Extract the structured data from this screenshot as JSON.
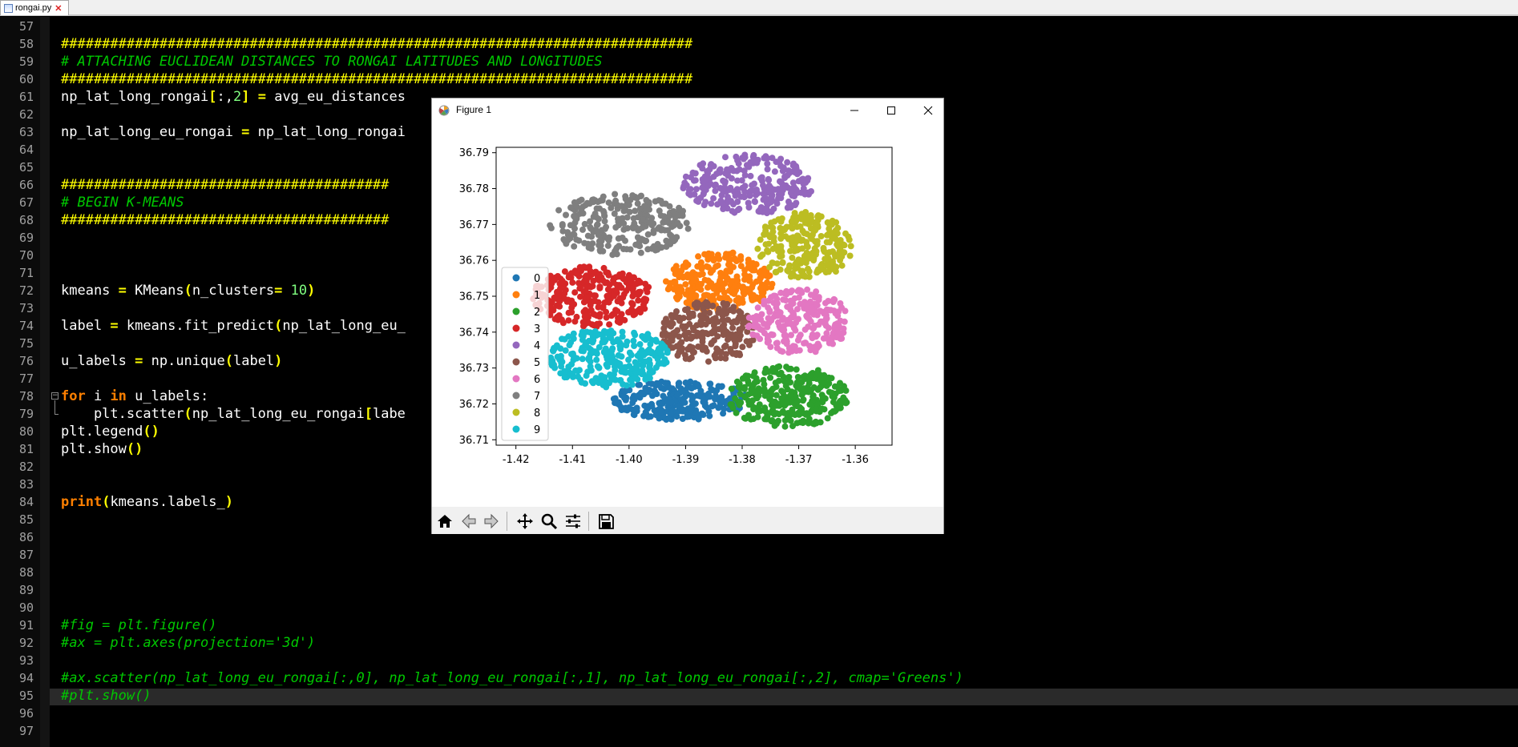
{
  "tab": {
    "filename": "rongai.py"
  },
  "editor": {
    "lines": [
      {
        "n": "57",
        "html": ""
      },
      {
        "n": "58",
        "html": "<span class='hash'>#############################################################################</span>"
      },
      {
        "n": "59",
        "html": "<span class='cmt'># ATTACHING EUCLIDEAN DISTANCES TO RONGAI LATITUDES AND LONGITUDES</span>"
      },
      {
        "n": "60",
        "html": "<span class='hash'>#############################################################################</span>"
      },
      {
        "n": "61",
        "html": "np_lat_long_rongai<span class='op'>[</span>:,<span class='num'>2</span><span class='op'>]</span> <span class='op'>=</span> avg_eu_distances"
      },
      {
        "n": "62",
        "html": ""
      },
      {
        "n": "63",
        "html": "np_lat_long_eu_rongai <span class='op'>=</span> np_lat_long_rongai"
      },
      {
        "n": "64",
        "html": ""
      },
      {
        "n": "65",
        "html": ""
      },
      {
        "n": "66",
        "html": "<span class='hash'>########################################</span>"
      },
      {
        "n": "67",
        "html": "<span class='cmt'># BEGIN K-MEANS</span>"
      },
      {
        "n": "68",
        "html": "<span class='hash'>########################################</span>"
      },
      {
        "n": "69",
        "html": ""
      },
      {
        "n": "70",
        "html": ""
      },
      {
        "n": "71",
        "html": ""
      },
      {
        "n": "72",
        "html": "kmeans <span class='op'>=</span> KMeans<span class='op'>(</span>n_clusters<span class='op'>=</span> <span class='num'>10</span><span class='op'>)</span>"
      },
      {
        "n": "73",
        "html": ""
      },
      {
        "n": "74",
        "html": "label <span class='op'>=</span> kmeans.fit_predict<span class='op'>(</span>np_lat_long_eu_"
      },
      {
        "n": "75",
        "html": ""
      },
      {
        "n": "76",
        "html": "u_labels <span class='op'>=</span> np.unique<span class='op'>(</span>label<span class='op'>)</span>"
      },
      {
        "n": "77",
        "html": ""
      },
      {
        "n": "78",
        "html": "<span class='kw'>for</span> i <span class='kw'>in</span> u_labels:"
      },
      {
        "n": "79",
        "html": "    plt.scatter<span class='op'>(</span>np_lat_long_eu_rongai<span class='op'>[</span>labe                                                      l <span class='op'>=</span> i<span class='op'>)</span>"
      },
      {
        "n": "80",
        "html": "plt.legend<span class='op'>()</span>"
      },
      {
        "n": "81",
        "html": "plt.show<span class='op'>()</span>"
      },
      {
        "n": "82",
        "html": ""
      },
      {
        "n": "83",
        "html": ""
      },
      {
        "n": "84",
        "html": "<span class='kw'>print</span><span class='op'>(</span>kmeans.labels_<span class='op'>)</span>"
      },
      {
        "n": "85",
        "html": ""
      },
      {
        "n": "86",
        "html": ""
      },
      {
        "n": "87",
        "html": ""
      },
      {
        "n": "88",
        "html": ""
      },
      {
        "n": "89",
        "html": ""
      },
      {
        "n": "90",
        "html": ""
      },
      {
        "n": "91",
        "html": "<span class='cmt'>#fig = plt.figure()</span>"
      },
      {
        "n": "92",
        "html": "<span class='cmt'>#ax = plt.axes(projection='3d')</span>"
      },
      {
        "n": "93",
        "html": ""
      },
      {
        "n": "94",
        "html": "<span class='cmt'>#ax.scatter(np_lat_long_eu_rongai[:,0], np_lat_long_eu_rongai[:,1], np_lat_long_eu_rongai[:,2], cmap='Greens')</span>"
      },
      {
        "n": "95",
        "html": "<span class='cmt'>#plt.show()</span>"
      },
      {
        "n": "96",
        "html": ""
      },
      {
        "n": "97",
        "html": ""
      }
    ]
  },
  "figure": {
    "title": "Figure 1",
    "minimize": "🗕",
    "maximize": "☐",
    "close": "✕"
  },
  "chart_data": {
    "type": "scatter",
    "xlim": [
      -1.4235,
      -1.3535
    ],
    "ylim": [
      36.7085,
      36.7915
    ],
    "xticks": [
      "-1.42",
      "-1.41",
      "-1.40",
      "-1.39",
      "-1.38",
      "-1.37",
      "-1.36"
    ],
    "xtick_values": [
      -1.42,
      -1.41,
      -1.4,
      -1.39,
      -1.38,
      -1.37,
      -1.36
    ],
    "yticks": [
      "36.71",
      "36.72",
      "36.73",
      "36.74",
      "36.75",
      "36.76",
      "36.77",
      "36.78",
      "36.79"
    ],
    "ytick_values": [
      36.71,
      36.72,
      36.73,
      36.74,
      36.75,
      36.76,
      36.77,
      36.78,
      36.79
    ],
    "legend_position": "left",
    "series": [
      {
        "name": "0",
        "color": "#1f77b4",
        "cx": -1.391,
        "cy": 36.721,
        "rx": 0.012,
        "ry": 0.0055,
        "n": 260
      },
      {
        "name": "1",
        "color": "#ff7f0e",
        "cx": -1.384,
        "cy": 36.754,
        "rx": 0.0095,
        "ry": 0.0085,
        "n": 260
      },
      {
        "name": "2",
        "color": "#2ca02c",
        "cx": -1.372,
        "cy": 36.722,
        "rx": 0.011,
        "ry": 0.0085,
        "n": 300
      },
      {
        "name": "3",
        "color": "#d62728",
        "cx": -1.4065,
        "cy": 36.75,
        "rx": 0.0105,
        "ry": 0.0085,
        "n": 280
      },
      {
        "name": "4",
        "color": "#9467bd",
        "cx": -1.379,
        "cy": 36.781,
        "rx": 0.0115,
        "ry": 0.0085,
        "n": 260
      },
      {
        "name": "5",
        "color": "#8c564b",
        "cx": -1.386,
        "cy": 36.74,
        "rx": 0.0085,
        "ry": 0.0085,
        "n": 220
      },
      {
        "name": "6",
        "color": "#e377c2",
        "cx": -1.37,
        "cy": 36.743,
        "rx": 0.009,
        "ry": 0.009,
        "n": 240
      },
      {
        "name": "7",
        "color": "#7f7f7f",
        "cx": -1.4015,
        "cy": 36.77,
        "rx": 0.0125,
        "ry": 0.0085,
        "n": 260
      },
      {
        "name": "8",
        "color": "#bcbd22",
        "cx": -1.369,
        "cy": 36.764,
        "rx": 0.0085,
        "ry": 0.0095,
        "n": 240
      },
      {
        "name": "9",
        "color": "#17becf",
        "cx": -1.4035,
        "cy": 36.733,
        "rx": 0.0105,
        "ry": 0.0085,
        "n": 260
      }
    ]
  },
  "toolbar": {
    "buttons": [
      "home-icon",
      "back-icon",
      "forward-icon",
      "pan-icon",
      "zoom-icon",
      "configure-icon",
      "save-icon"
    ]
  }
}
